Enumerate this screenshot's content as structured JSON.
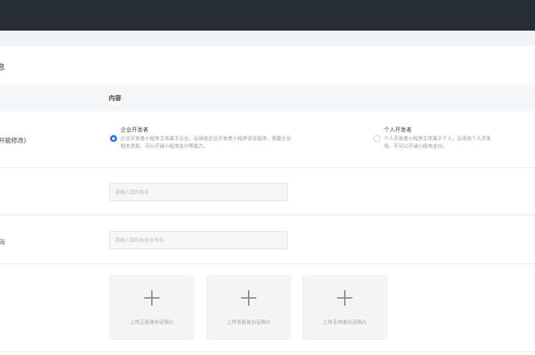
{
  "section": {
    "title": "息"
  },
  "table": {
    "content_header": "内容"
  },
  "rows": {
    "developer_type": {
      "label": "开能修改)",
      "options": [
        {
          "title": "企业开发者",
          "desc_line1": "企业开发者小程序主体属于企业，后续由企业开发者小程序验证程序，需要企业",
          "desc_line2": "相关资质，可以开通小程序支付等能力。",
          "selected": true
        },
        {
          "title": "个人开发者",
          "desc_line1": "个人开发者小程序主体属于个人，后续由个人开发",
          "desc_line2": "限，不可以开通小程序支付。",
          "selected": false
        }
      ]
    },
    "name": {
      "placeholder": "请输入您的姓名"
    },
    "id_number": {
      "label": "码",
      "placeholder": "请输入您的身份证号码"
    },
    "uploads": [
      {
        "label": "上传正面身份证照片",
        "icon": "plus-icon"
      },
      {
        "label": "上传背面身份证照片",
        "icon": "plus-icon"
      },
      {
        "label": "上传手持身份证照片",
        "icon": "plus-icon"
      }
    ]
  },
  "colors": {
    "topbar": "#262c35",
    "accent": "#2b6bff"
  }
}
